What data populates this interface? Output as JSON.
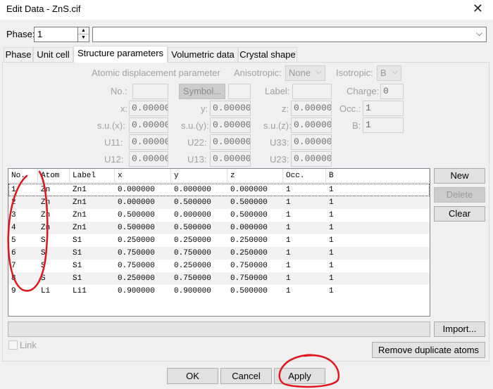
{
  "window": {
    "title": "Edit Data - ZnS.cif",
    "close_icon": "✕"
  },
  "phase": {
    "label": "Phase:",
    "value": "1",
    "name_value": ""
  },
  "tabs": [
    {
      "label": "Phase",
      "active": false
    },
    {
      "label": "Unit cell",
      "active": false
    },
    {
      "label": "Structure parameters",
      "active": true
    },
    {
      "label": "Volumetric data",
      "active": false
    },
    {
      "label": "Crystal shape",
      "active": false
    }
  ],
  "params": {
    "adp_label": "Atomic displacement parameter",
    "anisotropic_label": "Anisotropic:",
    "anisotropic_value": "None",
    "isotropic_label": "Isotropic:",
    "isotropic_value": "B",
    "no_label": "No.:",
    "no_value": "",
    "symbol_button": "Symbol...",
    "symbol_value": "",
    "label_label": "Label:",
    "label_value": "",
    "charge_label": "Charge:",
    "charge_value": "0",
    "x_label": "x:",
    "x_value": "0.000000",
    "y_label": "y:",
    "y_value": "0.000000",
    "z_label": "z:",
    "z_value": "0.000000",
    "occ_label": "Occ.:",
    "occ_value": "1",
    "sux_label": "s.u.(x):",
    "sux_value": "0.000000",
    "suy_label": "s.u.(y):",
    "suy_value": "0.000000",
    "suz_label": "s.u.(z):",
    "suz_value": "0.000000",
    "b_label": "B:",
    "b_value": "1",
    "u11_label": "U11:",
    "u11_value": "0.000000",
    "u22_label": "U22:",
    "u22_value": "0.000000",
    "u33_label": "U33:",
    "u33_value": "0.000000",
    "u12_label": "U12:",
    "u12_value": "0.000000",
    "u13_label": "U13:",
    "u13_value": "0.000000",
    "u23_label": "U23:",
    "u23_value": "0.000000"
  },
  "table": {
    "headers": [
      "No.",
      "Atom",
      "Label",
      "x",
      "y",
      "z",
      "Occ.",
      "B"
    ],
    "rows": [
      [
        "1",
        "Zn",
        "Zn1",
        "0.000000",
        "0.000000",
        "0.000000",
        "1",
        "1"
      ],
      [
        "2",
        "Zn",
        "Zn1",
        "0.000000",
        "0.500000",
        "0.500000",
        "1",
        "1"
      ],
      [
        "3",
        "Zn",
        "Zn1",
        "0.500000",
        "0.000000",
        "0.500000",
        "1",
        "1"
      ],
      [
        "4",
        "Zn",
        "Zn1",
        "0.500000",
        "0.500000",
        "0.000000",
        "1",
        "1"
      ],
      [
        "5",
        "S",
        "S1",
        "0.250000",
        "0.250000",
        "0.250000",
        "1",
        "1"
      ],
      [
        "6",
        "S",
        "S1",
        "0.750000",
        "0.750000",
        "0.250000",
        "1",
        "1"
      ],
      [
        "7",
        "S",
        "S1",
        "0.750000",
        "0.250000",
        "0.750000",
        "1",
        "1"
      ],
      [
        "8",
        "S",
        "S1",
        "0.250000",
        "0.750000",
        "0.750000",
        "1",
        "1"
      ],
      [
        "9",
        "Li",
        "Li1",
        "0.900000",
        "0.900000",
        "0.500000",
        "1",
        "1"
      ]
    ]
  },
  "side_buttons": {
    "new": "New",
    "delete": "Delete",
    "clear": "Clear"
  },
  "import_button": "Import...",
  "path_value": "",
  "link_label": "Link",
  "remove_duplicates_button": "Remove duplicate atoms",
  "footer": {
    "ok": "OK",
    "cancel": "Cancel",
    "apply": "Apply"
  },
  "annotation_color": "#e0151d"
}
